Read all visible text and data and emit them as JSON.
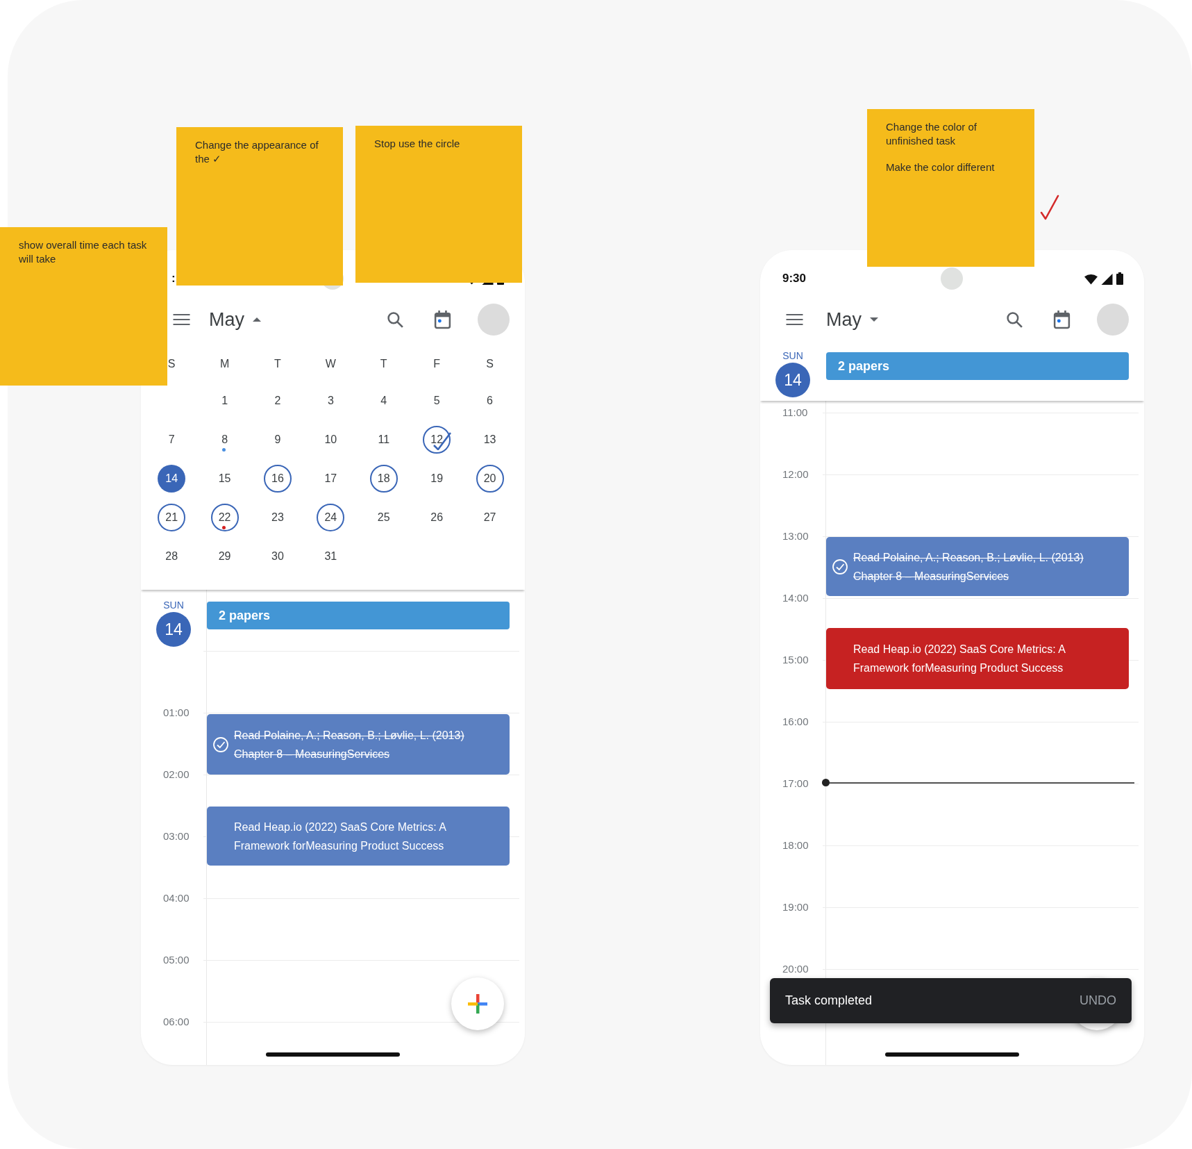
{
  "sticky_notes": [
    {
      "paragraphs": [
        "Change the appearance of the ✓"
      ]
    },
    {
      "paragraphs": [
        "Stop use the circle"
      ]
    },
    {
      "paragraphs": [
        "show overall time each task will take"
      ]
    },
    {
      "paragraphs": [
        "Change the color of unfinished task",
        "Make the color different"
      ]
    }
  ],
  "phones": [
    {
      "status_bar": {
        "time": ":"
      },
      "app_bar": {
        "month": "May",
        "expanded": true
      },
      "month_grid": {
        "weekdays": [
          "S",
          "M",
          "T",
          "W",
          "T",
          "F",
          "S"
        ],
        "weeks": [
          [
            {
              "label": "1",
              "selected": false,
              "ringed": false,
              "checked": false
            },
            {
              "label": "2",
              "selected": false,
              "ringed": false,
              "checked": false
            },
            {
              "label": "3",
              "selected": false,
              "ringed": false,
              "checked": false
            },
            {
              "label": "4",
              "selected": false,
              "ringed": false,
              "checked": false
            },
            {
              "label": "5",
              "selected": false,
              "ringed": false,
              "checked": false
            },
            {
              "label": "6",
              "selected": false,
              "ringed": false,
              "checked": false
            }
          ],
          [
            {
              "label": "7",
              "selected": false,
              "ringed": false,
              "checked": false
            },
            {
              "label": "8",
              "selected": false,
              "ringed": false,
              "checked": false,
              "color": "#4a8fe0"
            },
            {
              "label": "9",
              "selected": false,
              "ringed": false,
              "checked": false
            },
            {
              "label": "10",
              "selected": false,
              "ringed": false,
              "checked": false
            },
            {
              "label": "11",
              "selected": false,
              "ringed": false,
              "checked": false
            },
            {
              "label": "12",
              "selected": false,
              "ringed": true,
              "checked": true
            },
            {
              "label": "13",
              "selected": false,
              "ringed": false,
              "checked": false
            }
          ],
          [
            {
              "label": "14",
              "selected": true,
              "ringed": false,
              "checked": false
            },
            {
              "label": "15",
              "selected": false,
              "ringed": false,
              "checked": false
            },
            {
              "label": "16",
              "selected": false,
              "ringed": true,
              "checked": false
            },
            {
              "label": "17",
              "selected": false,
              "ringed": false,
              "checked": false
            },
            {
              "label": "18",
              "selected": false,
              "ringed": true,
              "checked": false
            },
            {
              "label": "19",
              "selected": false,
              "ringed": false,
              "checked": false
            },
            {
              "label": "20",
              "selected": false,
              "ringed": true,
              "checked": false
            }
          ],
          [
            {
              "label": "21",
              "selected": false,
              "ringed": true,
              "checked": false
            },
            {
              "label": "22",
              "selected": false,
              "ringed": true,
              "checked": false,
              "color": "#d32020"
            },
            {
              "label": "23",
              "selected": false,
              "ringed": false,
              "checked": false
            },
            {
              "label": "24",
              "selected": false,
              "ringed": true,
              "checked": false
            },
            {
              "label": "25",
              "selected": false,
              "ringed": false,
              "checked": false
            },
            {
              "label": "26",
              "selected": false,
              "ringed": false,
              "checked": false
            },
            {
              "label": "27",
              "selected": false,
              "ringed": false,
              "checked": false
            }
          ],
          [
            {
              "label": "28",
              "selected": false,
              "ringed": false,
              "checked": false
            },
            {
              "label": "29",
              "selected": false,
              "ringed": false,
              "checked": false
            },
            {
              "label": "30",
              "selected": false,
              "ringed": false,
              "checked": false
            },
            {
              "label": "31",
              "selected": false,
              "ringed": false,
              "checked": false
            }
          ]
        ]
      },
      "day_header": {
        "weekday": "SUN",
        "date": "14"
      },
      "all_day": [
        {
          "title": "2 papers"
        }
      ],
      "hours": [
        "01:00",
        "02:00",
        "03:00",
        "04:00",
        "05:00",
        "06:00"
      ],
      "events": [
        {
          "title": "Read Polaine, A.; Reason, B.; Løvlie, L. (2013) Chapter 8 – MeasuringServices",
          "done": true,
          "color": "#5a7fc1"
        },
        {
          "title": "Read Heap.io (2022) SaaS Core Metrics: A Framework forMeasuring Product Success",
          "done": false,
          "color": "#5a7fc1"
        }
      ]
    },
    {
      "status_bar": {
        "time": "9:30"
      },
      "app_bar": {
        "month": "May",
        "expanded": false
      },
      "day_header": {
        "weekday": "SUN",
        "date": "14"
      },
      "all_day": [
        {
          "title": "2 papers"
        }
      ],
      "hours": [
        "11:00",
        "12:00",
        "13:00",
        "14:00",
        "15:00",
        "16:00",
        "17:00",
        "18:00",
        "19:00",
        "20:00"
      ],
      "events": [
        {
          "title": "Read Polaine, A.; Reason, B.; Løvlie, L. (2013) Chapter 8 – MeasuringServices",
          "done": true,
          "color": "#5a7fc1"
        },
        {
          "title": "Read Heap.io (2022) SaaS Core Metrics: A Framework forMeasuring Product Success",
          "done": false,
          "color": "#c62222"
        }
      ],
      "now_indicator": true,
      "snackbar": {
        "message": "Task completed",
        "action": "UNDO"
      }
    }
  ]
}
